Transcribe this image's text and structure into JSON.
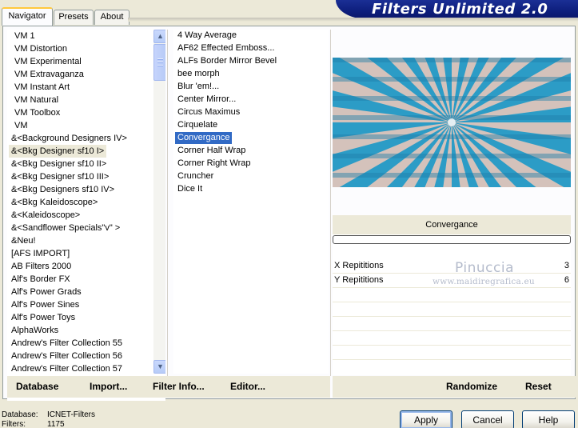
{
  "window": {
    "title": "Filters Unlimited 2.0"
  },
  "tabs": [
    {
      "label": "Navigator",
      "active": true
    },
    {
      "label": "Presets",
      "active": false
    },
    {
      "label": "About",
      "active": false
    }
  ],
  "categories": {
    "selected_index": 9,
    "items": [
      "VM 1",
      "VM Distortion",
      "VM Experimental",
      "VM Extravaganza",
      "VM Instant Art",
      "VM Natural",
      "VM Toolbox",
      "VM",
      "&<Background Designers IV>",
      "&<Bkg Designer sf10 I>",
      "&<Bkg Designer sf10 II>",
      "&<Bkg Designer sf10 III>",
      "&<Bkg Designers sf10 IV>",
      "&<Bkg Kaleidoscope>",
      "&<Kaleidoscope>",
      "&<Sandflower Specials\"v\" >",
      "&Neu!",
      "[AFS IMPORT]",
      "AB Filters 2000",
      "Alf's Border FX",
      "Alf's Power Grads",
      "Alf's Power Sines",
      "Alf's Power Toys",
      "AlphaWorks",
      "Andrew's Filter Collection 55",
      "Andrew's Filter Collection 56",
      "Andrew's Filter Collection 57"
    ]
  },
  "filters": {
    "selected_index": 8,
    "items": [
      "4 Way Average",
      "AF62 Effected Emboss...",
      "ALFs Border Mirror Bevel",
      "bee morph",
      "Blur 'em!...",
      "Center Mirror...",
      "Circus Maximus",
      "Cirquelate",
      "Convergance",
      "Corner Half Wrap",
      "Corner Right Wrap",
      "Cruncher",
      "Dice It"
    ]
  },
  "left_footer": {
    "database": "Database",
    "import": "Import...",
    "filter_info": "Filter Info...",
    "editor": "Editor..."
  },
  "preview": {
    "filter_name": "Convergance"
  },
  "parameters": [
    {
      "label": "X Repititions",
      "value": "3"
    },
    {
      "label": "Y Repititions",
      "value": "6"
    }
  ],
  "watermark": {
    "name": "Pinuccia",
    "url": "www.maidiregrafica.eu"
  },
  "right_footer": {
    "randomize": "Randomize",
    "reset": "Reset"
  },
  "status": {
    "database_label": "Database:",
    "database_value": "ICNET-Filters",
    "filters_label": "Filters:",
    "filters_value": "1175"
  },
  "dialog": {
    "apply": "Apply",
    "cancel": "Cancel",
    "help": "Help"
  },
  "colors": {
    "face": "#ece9d8",
    "selection": "#316ac5",
    "banner": "#0e1f7e",
    "preview_blue": "#2c9cc6",
    "preview_peach": "#f2c9b9"
  },
  "icons": {
    "scroll_up": "scroll-up-arrow-icon",
    "scroll_down": "scroll-down-arrow-icon"
  }
}
